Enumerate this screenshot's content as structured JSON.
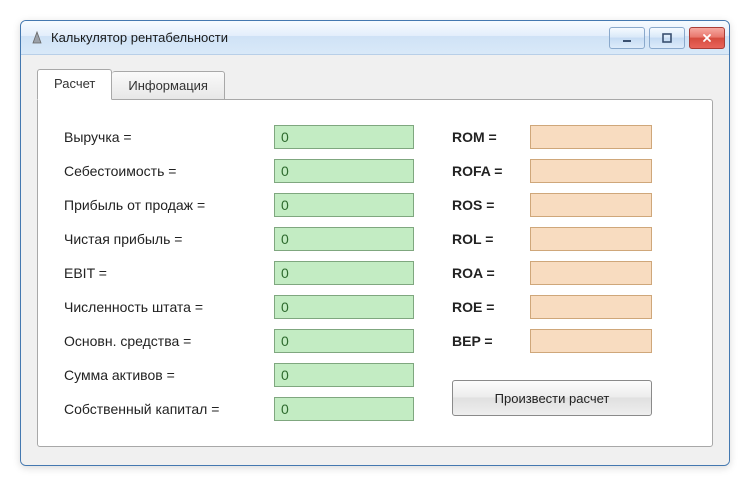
{
  "window": {
    "title": "Калькулятор рентабельности"
  },
  "tabs": {
    "calc": "Расчет",
    "info": "Информация"
  },
  "inputs": {
    "revenue": {
      "label": "Выручка  =",
      "value": "0"
    },
    "cost": {
      "label": "Себестоимость  =",
      "value": "0"
    },
    "salesProfit": {
      "label": "Прибыль от продаж  =",
      "value": "0"
    },
    "netProfit": {
      "label": "Чистая прибыль  =",
      "value": "0"
    },
    "ebit": {
      "label": "EBIT  =",
      "value": "0"
    },
    "headcount": {
      "label": "Численность штата  =",
      "value": "0"
    },
    "fixedAssets": {
      "label": "Основн. средства  =",
      "value": "0"
    },
    "totalAssets": {
      "label": "Сумма активов  =",
      "value": "0"
    },
    "equity": {
      "label": "Собственный капитал  =",
      "value": "0"
    }
  },
  "outputs": {
    "rom": {
      "label": "ROM  =",
      "value": ""
    },
    "rofa": {
      "label": "ROFA  =",
      "value": ""
    },
    "ros": {
      "label": "ROS  =",
      "value": ""
    },
    "rol": {
      "label": "ROL  =",
      "value": ""
    },
    "roa": {
      "label": "ROA  =",
      "value": ""
    },
    "roe": {
      "label": "ROE  =",
      "value": ""
    },
    "bep": {
      "label": "BEP  =",
      "value": ""
    }
  },
  "buttons": {
    "calculate": "Произвести расчет"
  }
}
